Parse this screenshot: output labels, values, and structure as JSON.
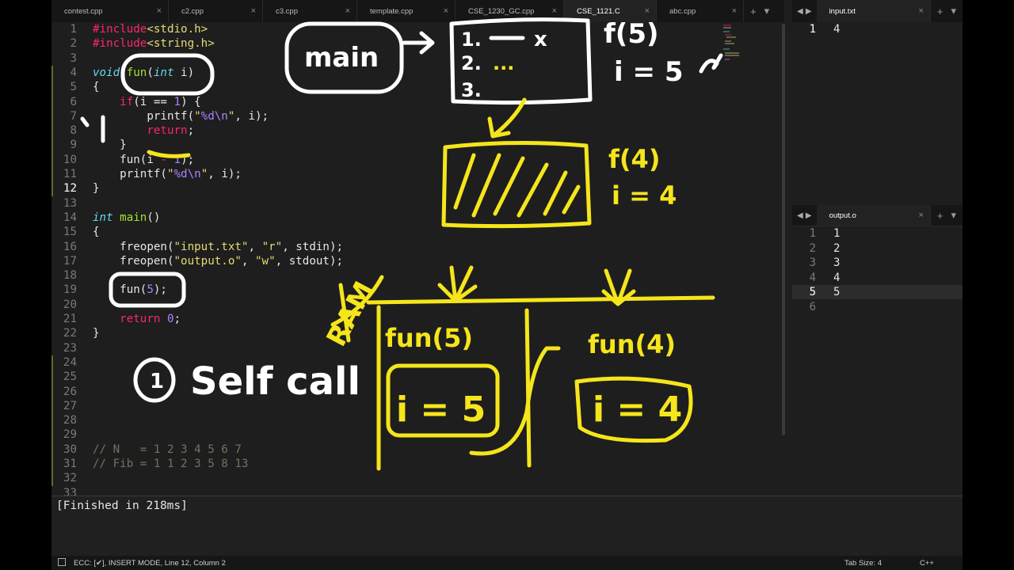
{
  "tabs": [
    {
      "label": "contest.cpp",
      "active": false
    },
    {
      "label": "c2.cpp",
      "active": false
    },
    {
      "label": "c3.cpp",
      "active": false
    },
    {
      "label": "template.cpp",
      "active": false
    },
    {
      "label": "CSE_1230_GC.cpp",
      "active": false
    },
    {
      "label": "CSE_1121.C",
      "active": true
    },
    {
      "label": "abc.cpp",
      "active": false
    }
  ],
  "tab_close_glyph": "×",
  "tab_add_glyph": "+",
  "tab_menu_glyph": "▾",
  "right_top_tab": "input.txt",
  "right_mid_tab": "output.o",
  "current_line": 12,
  "code_lines": [
    {
      "n": "1",
      "tokens": [
        [
          "r",
          "#include"
        ],
        [
          "s",
          "<stdio.h>"
        ]
      ]
    },
    {
      "n": "2",
      "tokens": [
        [
          "r",
          "#include"
        ],
        [
          "s",
          "<string.h>"
        ]
      ]
    },
    {
      "n": "3",
      "tokens": []
    },
    {
      "n": "4",
      "tokens": [
        [
          "k",
          "void"
        ],
        [
          "p",
          " "
        ],
        [
          "f",
          "fun"
        ],
        [
          "p",
          "("
        ],
        [
          "k",
          "int"
        ],
        [
          "p",
          " i)"
        ]
      ]
    },
    {
      "n": "5",
      "tokens": [
        [
          "p",
          "{"
        ]
      ]
    },
    {
      "n": "6",
      "tokens": [
        [
          "p",
          "    "
        ],
        [
          "r",
          "if"
        ],
        [
          "p",
          "(i == "
        ],
        [
          "n",
          "1"
        ],
        [
          "p",
          ") {"
        ]
      ]
    },
    {
      "n": "7",
      "tokens": [
        [
          "p",
          "        printf("
        ],
        [
          "s",
          "\""
        ],
        [
          "n",
          "%d\\n"
        ],
        [
          "s",
          "\""
        ],
        [
          "p",
          ", i);"
        ]
      ]
    },
    {
      "n": "8",
      "tokens": [
        [
          "p",
          "        "
        ],
        [
          "r",
          "return"
        ],
        [
          "p",
          ";"
        ]
      ]
    },
    {
      "n": "9",
      "tokens": [
        [
          "p",
          "    }"
        ]
      ]
    },
    {
      "n": "10",
      "tokens": [
        [
          "p",
          "    fun(i "
        ],
        [
          "r",
          "-"
        ],
        [
          "p",
          " "
        ],
        [
          "n",
          "1"
        ],
        [
          "p",
          ");"
        ]
      ]
    },
    {
      "n": "11",
      "tokens": [
        [
          "p",
          "    printf("
        ],
        [
          "s",
          "\""
        ],
        [
          "n",
          "%d\\n"
        ],
        [
          "s",
          "\""
        ],
        [
          "p",
          ", i);"
        ]
      ]
    },
    {
      "n": "12",
      "tokens": [
        [
          "p",
          "}"
        ]
      ]
    },
    {
      "n": "13",
      "tokens": []
    },
    {
      "n": "14",
      "tokens": [
        [
          "k",
          "int"
        ],
        [
          "p",
          " "
        ],
        [
          "f",
          "main"
        ],
        [
          "p",
          "()"
        ]
      ]
    },
    {
      "n": "15",
      "tokens": [
        [
          "p",
          "{"
        ]
      ]
    },
    {
      "n": "16",
      "tokens": [
        [
          "p",
          "    freopen("
        ],
        [
          "s",
          "\"input.txt\""
        ],
        [
          "p",
          ", "
        ],
        [
          "s",
          "\"r\""
        ],
        [
          "p",
          ", stdin);"
        ]
      ]
    },
    {
      "n": "17",
      "tokens": [
        [
          "p",
          "    freopen("
        ],
        [
          "s",
          "\"output.o\""
        ],
        [
          "p",
          ", "
        ],
        [
          "s",
          "\"w\""
        ],
        [
          "p",
          ", stdout);"
        ]
      ]
    },
    {
      "n": "18",
      "tokens": []
    },
    {
      "n": "19",
      "tokens": [
        [
          "p",
          "    fun("
        ],
        [
          "n",
          "5"
        ],
        [
          "p",
          ");"
        ]
      ]
    },
    {
      "n": "20",
      "tokens": []
    },
    {
      "n": "21",
      "tokens": [
        [
          "p",
          "    "
        ],
        [
          "r",
          "return"
        ],
        [
          "p",
          " "
        ],
        [
          "n",
          "0"
        ],
        [
          "p",
          ";"
        ]
      ]
    },
    {
      "n": "22",
      "tokens": [
        [
          "p",
          "}"
        ]
      ]
    },
    {
      "n": "23",
      "tokens": []
    },
    {
      "n": "24",
      "tokens": []
    },
    {
      "n": "25",
      "tokens": []
    },
    {
      "n": "26",
      "tokens": []
    },
    {
      "n": "27",
      "tokens": []
    },
    {
      "n": "28",
      "tokens": []
    },
    {
      "n": "29",
      "tokens": []
    },
    {
      "n": "30",
      "tokens": [
        [
          "c",
          "// N   = 1 2 3 4 5 6 7"
        ]
      ]
    },
    {
      "n": "31",
      "tokens": [
        [
          "c",
          "// Fib = 1 1 2 3 5 8 13"
        ]
      ]
    },
    {
      "n": "32",
      "tokens": []
    },
    {
      "n": "33",
      "tokens": []
    }
  ],
  "input_pane": {
    "lines": [
      {
        "n": "1",
        "v": "4"
      }
    ]
  },
  "output_pane": {
    "lines": [
      {
        "n": "1",
        "v": "1"
      },
      {
        "n": "2",
        "v": "2"
      },
      {
        "n": "3",
        "v": "3"
      },
      {
        "n": "4",
        "v": "4"
      },
      {
        "n": "5",
        "v": "5"
      },
      {
        "n": "6",
        "v": ""
      }
    ],
    "current_line": 5
  },
  "output_panel_text": "[Finished in 218ms]",
  "status": {
    "left": "ECC: [✔], INSERT MODE, Line 12, Column 2",
    "tab_size": "Tab Size: 4",
    "syntax": "C++"
  },
  "annotations": {
    "main": "main",
    "stack_1": "1.",
    "stack_x": "x",
    "stack_2": "2.",
    "stack_dots": "...",
    "stack_3": "3.",
    "f5": "f(5)",
    "i5": "i = 5",
    "f4": "f(4)",
    "i4": "i = 4",
    "ram": "RAM",
    "fun5": "fun(5)",
    "fun4": "fun(4)",
    "box_i5": "i = 5",
    "box_i4": "i = 4",
    "self_call_num": "1",
    "self_call": "Self call",
    "ink_color": "#f5e51b",
    "white_ink": "#ffffff"
  }
}
